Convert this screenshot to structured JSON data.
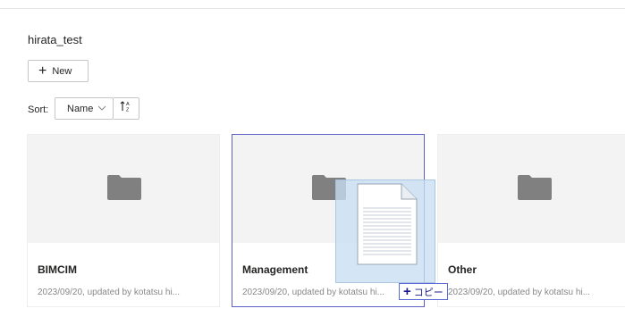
{
  "workspace": {
    "title": "hirata_test"
  },
  "toolbar": {
    "new_icon": "plus-icon",
    "new_label": "New"
  },
  "sort": {
    "label": "Sort:",
    "selected": "Name",
    "direction_icon": "sort-ascending-icon"
  },
  "items": [
    {
      "name": "BIMCIM",
      "meta": "2023/09/20, updated by kotatsu hi...",
      "icon": "folder-icon"
    },
    {
      "name": "Management",
      "meta": "2023/09/20, updated by kotatsu hi...",
      "icon": "folder-icon"
    },
    {
      "name": "Other",
      "meta": "2023/09/20, updated by kotatsu hi...",
      "icon": "folder-icon"
    }
  ],
  "drag": {
    "icon": "document-icon",
    "badge_plus": "+",
    "badge_label": "コピー"
  },
  "colors": {
    "accent": "#5c5fc4",
    "folder": "#808080",
    "thumb_bg": "#f3f3f3",
    "drag_bg": "#c8def4"
  }
}
